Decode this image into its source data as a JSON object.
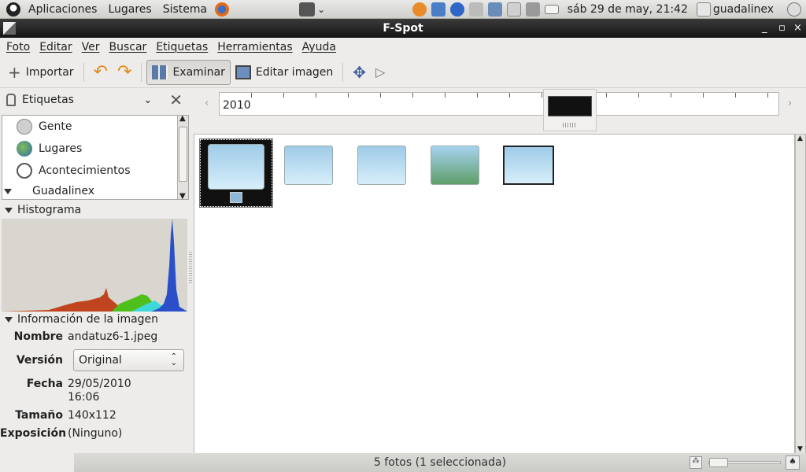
{
  "panel": {
    "menus": [
      "Aplicaciones",
      "Lugares",
      "Sistema"
    ],
    "clock": "sáb 29 de may, 21:42",
    "user": "guadalinex"
  },
  "window": {
    "title": "F-Spot"
  },
  "menubar": [
    "Foto",
    "Editar",
    "Ver",
    "Buscar",
    "Etiquetas",
    "Herramientas",
    "Ayuda"
  ],
  "toolbar": {
    "import_label": "Importar",
    "browse_label": "Examinar",
    "edit_label": "Editar imagen"
  },
  "sidebar": {
    "tags_header": "Etiquetas",
    "tags": [
      "Gente",
      "Lugares",
      "Acontecimientos",
      "Guadalinex"
    ],
    "histogram_header": "Histograma",
    "info_header": "Información de la imagen",
    "info": {
      "name_label": "Nombre",
      "name": "andatuz6-1.jpeg",
      "version_label": "Versión",
      "version": "Original",
      "date_label": "Fecha",
      "date": "29/05/2010",
      "time": "16:06",
      "size_label": "Tamaño",
      "size": "140x112",
      "exposure_label": "Exposición",
      "exposure": "(Ninguno)"
    }
  },
  "timeline": {
    "year": "2010"
  },
  "statusbar": {
    "text": "5 fotos (1 seleccionada)"
  },
  "colors": {
    "titlebar": "#1f1f1f",
    "selection": "#000000",
    "window_bg": "#edeceb"
  }
}
